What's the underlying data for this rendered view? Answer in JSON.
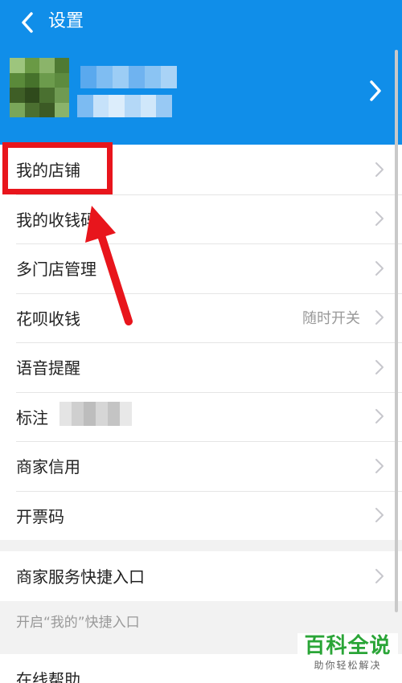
{
  "header": {
    "title": "设置",
    "back_icon": "chevron-left-icon",
    "profile_icon": "chevron-right-icon"
  },
  "menu": {
    "items": [
      {
        "label": "我的店铺"
      },
      {
        "label": "我的收钱码"
      },
      {
        "label": "多门店管理"
      },
      {
        "label": "花呗收钱",
        "value": "随时开关"
      },
      {
        "label": "语音提醒"
      },
      {
        "label": "标注"
      },
      {
        "label": "商家信用"
      },
      {
        "label": "开票码"
      }
    ]
  },
  "shortcut": {
    "label": "商家服务快捷入口",
    "hint": "开启“我的”快捷入口"
  },
  "help": {
    "label": "在线帮助"
  },
  "watermark": {
    "main": "百科全说",
    "sub": "助你轻松解决"
  },
  "colors": {
    "header_bg": "#108ee9",
    "highlight": "#e8151c",
    "watermark_green": "#2aa537"
  }
}
